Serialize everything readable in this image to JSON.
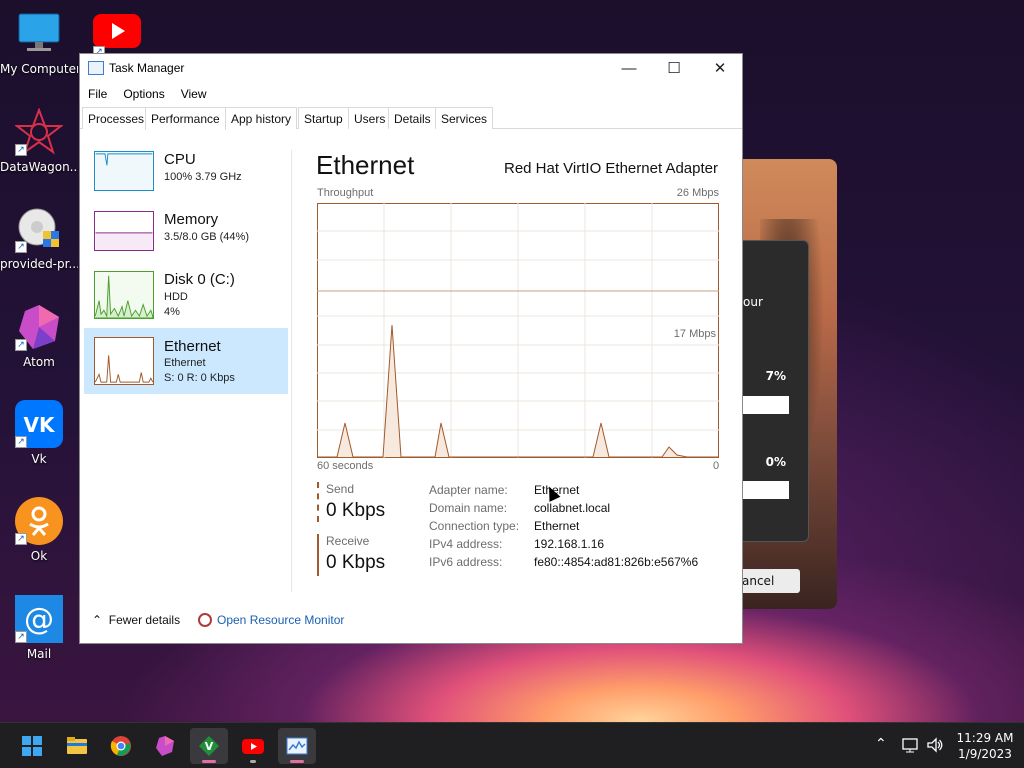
{
  "desktop": {
    "icons": [
      {
        "label": "My Computer"
      },
      {
        "label": "DataWagon..."
      },
      {
        "label": "provided-pr..."
      },
      {
        "label": "Atom"
      },
      {
        "label": "Vk"
      },
      {
        "label": "Ok"
      },
      {
        "label": "Mail"
      }
    ],
    "background_dialog": {
      "text_fragment": "our",
      "percent_1": "7%",
      "percent_2": "0%",
      "cancel_fragment": "ancel"
    }
  },
  "task_manager": {
    "title": "Task Manager",
    "menu": [
      "File",
      "Options",
      "View"
    ],
    "tabs": [
      "Processes",
      "Performance",
      "App history",
      "Startup",
      "Users",
      "Details",
      "Services"
    ],
    "active_tab": "Performance",
    "resources": [
      {
        "name": "CPU",
        "line1": "100%  3.79 GHz",
        "line2": "",
        "line3": ""
      },
      {
        "name": "Memory",
        "line1": "3.5/8.0 GB (44%)",
        "line2": "",
        "line3": ""
      },
      {
        "name": "Disk 0 (C:)",
        "line1": "HDD",
        "line2": "4%",
        "line3": ""
      },
      {
        "name": "Ethernet",
        "line1": "Ethernet",
        "line2": "S: 0  R: 0 Kbps",
        "line3": ""
      }
    ],
    "selected_resource": "Ethernet",
    "detail": {
      "title": "Ethernet",
      "adapter": "Red Hat VirtIO Ethernet Adapter",
      "throughput_label": "Throughput",
      "max_label": "26 Mbps",
      "mid_label": "17 Mbps",
      "time_label": "60 seconds",
      "zero_label": "0",
      "send_label": "Send",
      "send_value": "0 Kbps",
      "receive_label": "Receive",
      "receive_value": "0 Kbps",
      "properties": [
        {
          "key": "Adapter name:",
          "value": "Ethernet"
        },
        {
          "key": "Domain name:",
          "value": "collabnet.local"
        },
        {
          "key": "Connection type:",
          "value": "Ethernet"
        },
        {
          "key": "IPv4 address:",
          "value": "192.168.1.16"
        },
        {
          "key": "IPv6 address:",
          "value": "fe80::4854:ad81:826b:e567%6"
        }
      ]
    },
    "footer": {
      "fewer_details": "Fewer details",
      "open_resource_monitor": "Open Resource Monitor"
    }
  },
  "taskbar": {
    "apps": [
      "start-icon",
      "file-explorer-icon",
      "chrome-icon",
      "atom-icon",
      "vim-icon",
      "youtube-icon",
      "task-manager-icon"
    ],
    "clock_time": "11:29 AM",
    "clock_date": "1/9/2023"
  },
  "colors": {
    "accent_selected": "#cce8ff",
    "network_line": "#a05a2c",
    "link": "#1a5fb4"
  }
}
